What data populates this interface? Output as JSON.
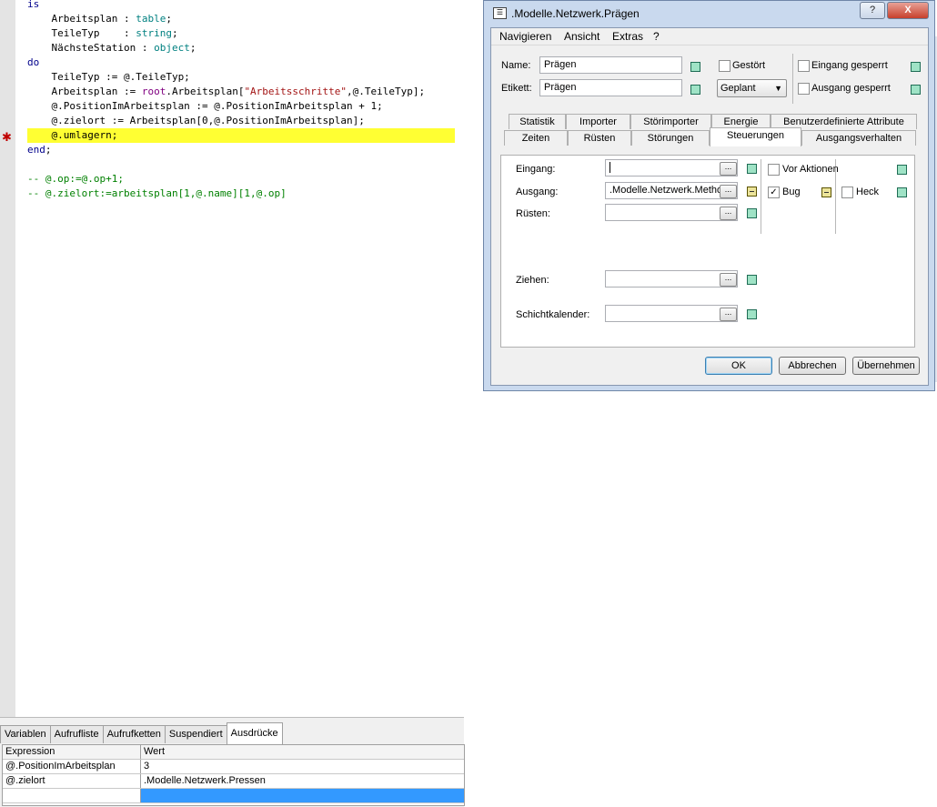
{
  "editor": {
    "lines": [
      {
        "parts": [
          {
            "t": "is",
            "c": "kw"
          }
        ]
      },
      {
        "parts": [
          {
            "t": "    Arbeitsplan : ",
            "c": ""
          },
          {
            "t": "table",
            "c": "ty"
          },
          {
            "t": ";",
            "c": ""
          }
        ]
      },
      {
        "parts": [
          {
            "t": "    TeileTyp    : ",
            "c": ""
          },
          {
            "t": "string",
            "c": "ty"
          },
          {
            "t": ";",
            "c": ""
          }
        ]
      },
      {
        "parts": [
          {
            "t": "    NächsteStation : ",
            "c": ""
          },
          {
            "t": "object",
            "c": "ty"
          },
          {
            "t": ";",
            "c": ""
          }
        ]
      },
      {
        "parts": [
          {
            "t": "do",
            "c": "kw"
          }
        ]
      },
      {
        "parts": [
          {
            "t": "    TeileTyp := @.TeileTyp;",
            "c": ""
          }
        ]
      },
      {
        "parts": [
          {
            "t": "    Arbeitsplan := ",
            "c": ""
          },
          {
            "t": "root",
            "c": "fn"
          },
          {
            "t": ".Arbeitsplan[",
            "c": ""
          },
          {
            "t": "\"Arbeitsschritte\"",
            "c": "str"
          },
          {
            "t": ",@.TeileTyp];",
            "c": ""
          }
        ]
      },
      {
        "parts": [
          {
            "t": "    @.PositionImArbeitsplan := @.PositionImArbeitsplan + 1;",
            "c": ""
          }
        ]
      },
      {
        "parts": [
          {
            "t": "    @.zielort := Arbeitsplan[0,@.PositionImArbeitsplan];",
            "c": ""
          }
        ]
      },
      {
        "parts": [
          {
            "t": "    @.umlagern;",
            "c": ""
          }
        ],
        "highlight": true
      },
      {
        "parts": [
          {
            "t": "end",
            "c": "kw"
          },
          {
            "t": ";",
            "c": ""
          }
        ]
      },
      {
        "parts": [
          {
            "t": "",
            "c": ""
          }
        ]
      },
      {
        "parts": [
          {
            "t": "-- @.op:=@.op+1;",
            "c": "cm"
          }
        ]
      },
      {
        "parts": [
          {
            "t": "-- @.zielort:=arbeitsplan[1,@.name][1,@.op]",
            "c": "cm"
          }
        ]
      }
    ],
    "breakpoint_marker": "✱"
  },
  "debug_panel": {
    "tabs": [
      "Variablen",
      "Aufrufliste",
      "Aufrufketten",
      "Suspendiert",
      "Ausdrücke"
    ],
    "active_tab": "Ausdrücke",
    "columns": [
      "Expression",
      "Wert"
    ],
    "rows": [
      {
        "expr": "@.PositionImArbeitsplan",
        "value": "3"
      },
      {
        "expr": "@.zielort",
        "value": ".Modelle.Netzwerk.Pressen"
      }
    ]
  },
  "dialog": {
    "title": ".Modelle.Netzwerk.Prägen",
    "help_btn": "?",
    "close_btn": "X",
    "menu": [
      "Navigieren",
      "Ansicht",
      "Extras",
      "?"
    ],
    "name_label": "Name:",
    "name_value": "Prägen",
    "label_label": "Etikett:",
    "label_value": "Prägen",
    "gestoert_label": "Gestört",
    "geplant_value": "Geplant",
    "eingang_gesperrt_label": "Eingang gesperrt",
    "ausgang_gesperrt_label": "Ausgang gesperrt",
    "tabs_row1": [
      "Statistik",
      "Importer",
      "Störimporter",
      "Energie",
      "Benutzerdefinierte Attribute"
    ],
    "tabs_row2": [
      "Zeiten",
      "Rüsten",
      "Störungen",
      "Steuerungen",
      "Ausgangsverhalten"
    ],
    "active_tab": "Steuerungen",
    "fields": {
      "eingang_label": "Eingang:",
      "eingang_value": "",
      "ausgang_label": "Ausgang:",
      "ausgang_value": ".Modelle.Netzwerk.Methode",
      "ruesten_label": "Rüsten:",
      "ruesten_value": "",
      "ziehen_label": "Ziehen:",
      "ziehen_value": "",
      "schicht_label": "Schichtkalender:",
      "schicht_value": "",
      "browse": "..."
    },
    "vor_aktionen_label": "Vor Aktionen",
    "bug_label": "Bug",
    "bug_checked": "✓",
    "heck_label": "Heck",
    "ok": "OK",
    "abbrechen": "Abbrechen",
    "uebernehmen": "Übernehmen",
    "colors": {
      "status_green": "#9fe3c6",
      "status_yellow": "#ece49a",
      "highlight": "#ffff33",
      "selection": "#3399ff"
    }
  }
}
